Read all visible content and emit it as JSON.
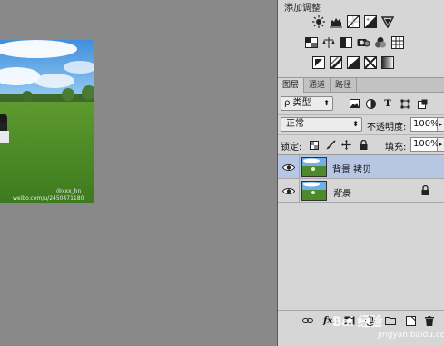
{
  "adjustments": {
    "title": "添加调整",
    "row1": [
      "brightness-contrast-icon",
      "levels-icon",
      "curves-icon",
      "exposure-icon",
      "vibrance-icon"
    ],
    "row2": [
      "hue-saturation-icon",
      "color-balance-icon",
      "black-white-icon",
      "photo-filter-icon",
      "channel-mixer-icon",
      "color-lookup-icon"
    ],
    "row3": [
      "invert-icon",
      "posterize-icon",
      "threshold-icon",
      "selective-color-icon",
      "gradient-map-icon"
    ]
  },
  "layers_panel": {
    "tabs": [
      "图层",
      "通道",
      "路径"
    ],
    "active_tab": "图层",
    "filter": {
      "value": "类型",
      "icon_search": "ρ"
    },
    "filter_icons": [
      "image-filter-icon",
      "adjustment-filter-icon",
      "type-filter-icon",
      "shape-filter-icon",
      "smart-object-filter-icon"
    ],
    "type_icon_glyph": "T",
    "blend_mode": "正常",
    "opacity_label": "不透明度:",
    "opacity_value": "100%",
    "lock_label": "锁定:",
    "fill_label": "填充:",
    "fill_value": "100%",
    "layers": [
      {
        "name": "背景 拷贝",
        "selected": true,
        "italic": false,
        "locked": false
      },
      {
        "name": "背景",
        "selected": false,
        "italic": true,
        "locked": true
      }
    ],
    "footer_icons": [
      "link-icon",
      "fx-icon",
      "mask-icon",
      "adjustment-layer-icon",
      "group-icon",
      "new-layer-icon",
      "delete-icon"
    ],
    "fx_glyph": "fx."
  },
  "canvas": {
    "watermark_user": "@xxx_hn",
    "watermark_url": "weibo.com/u/2450471180"
  },
  "site_watermark": {
    "brand": "Bai 经验",
    "url": "jingyan.baidu.com"
  },
  "colors": {
    "panel_bg": "#d6d6d6",
    "canvas_bg": "#898989",
    "selected_layer": "#b7c7e3"
  }
}
